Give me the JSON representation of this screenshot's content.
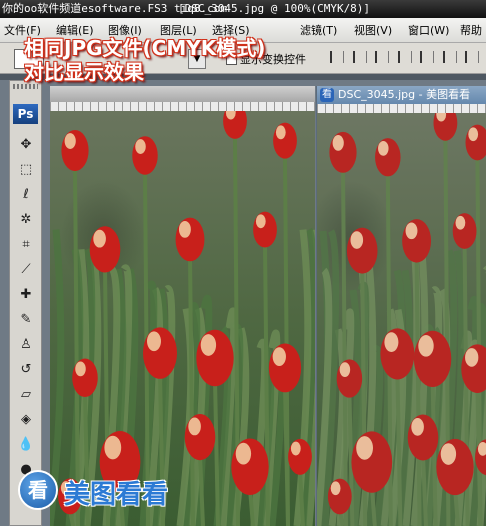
{
  "window": {
    "app_title": "你的oo软件频道esoftware.FS3 tiq8.com",
    "doc_title": "[DSC_3045.jpg @ 100%(CMYK/8)]"
  },
  "menubar": {
    "items": [
      "文件(F)",
      "编辑(E)",
      "图像(I)",
      "图层(L)",
      "选择(S)",
      "滤镜(T)",
      "视图(V)",
      "窗口(W)",
      "帮助"
    ]
  },
  "options_bar": {
    "checkbox_label": "显示变换控件"
  },
  "toolbox": {
    "logo": "Ps",
    "tools": [
      {
        "icon": "move-tool-icon",
        "glyph": "✥"
      },
      {
        "icon": "marquee-tool-icon",
        "glyph": "⬚"
      },
      {
        "icon": "lasso-tool-icon",
        "glyph": "ℓ"
      },
      {
        "icon": "magic-wand-icon",
        "glyph": "✲"
      },
      {
        "icon": "crop-tool-icon",
        "glyph": "⌗"
      },
      {
        "icon": "slice-tool-icon",
        "glyph": "⟋"
      },
      {
        "icon": "healing-brush-icon",
        "glyph": "✚"
      },
      {
        "icon": "brush-tool-icon",
        "glyph": "✎"
      },
      {
        "icon": "clone-stamp-icon",
        "glyph": "♙"
      },
      {
        "icon": "history-brush-icon",
        "glyph": "↺"
      },
      {
        "icon": "eraser-tool-icon",
        "glyph": "▱"
      },
      {
        "icon": "paint-bucket-icon",
        "glyph": "◈"
      },
      {
        "icon": "blur-tool-icon",
        "glyph": "💧"
      },
      {
        "icon": "dodge-tool-icon",
        "glyph": "●"
      },
      {
        "icon": "pen-tool-icon",
        "glyph": "✒"
      }
    ]
  },
  "viewer_window": {
    "app_icon": "看",
    "title": "DSC_3045.jpg - 美图看看"
  },
  "caption": {
    "line1": "相同JPG文件(CMYK模式)",
    "line2": "对比显示效果"
  },
  "watermark": {
    "badge": "看",
    "text": "美图看看"
  }
}
